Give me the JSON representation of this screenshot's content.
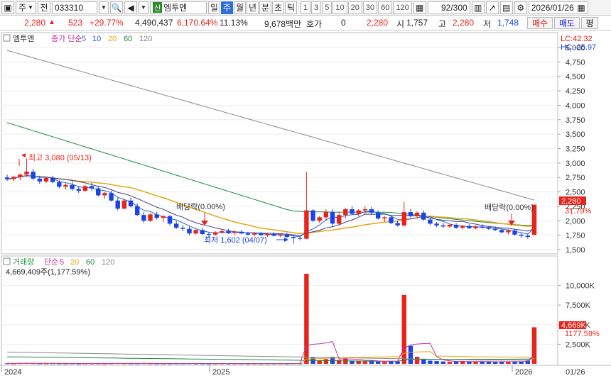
{
  "toolbar": {
    "type_label": "주",
    "mode_label": "전",
    "stock_code": "033310",
    "new_tag": "신",
    "stock_name": "엠투엔",
    "periods": [
      "일",
      "주",
      "월",
      "년",
      "분",
      "초",
      "틱"
    ],
    "active_period": "주",
    "intervals": [
      "1",
      "3",
      "5",
      "10",
      "20",
      "30",
      "60",
      "120"
    ],
    "count": "92",
    "count_total": "/300",
    "date": "2026/01/26"
  },
  "quote": {
    "price": "2,280",
    "change": "523",
    "change_pct": "+29.77%",
    "volume": "4,490,437",
    "volume_pct": "6,170.64%",
    "turnover": "11.13%",
    "amount": "9,678백만",
    "hoga_label": "호가",
    "hoga_value": "0",
    "hoga_price": "2,280",
    "open_label": "시",
    "open": "1,757",
    "high_label": "고",
    "high": "2,280",
    "low_label": "저",
    "low": "1,748",
    "buy_label": "매수",
    "sell_label": "매도",
    "avg_label": "평"
  },
  "price_panel": {
    "legend_name": "엠투엔",
    "legend_items": [
      {
        "label": "종가 단순",
        "color": "#c0309a"
      },
      {
        "label": "5",
        "color": "#2f5fd0"
      },
      {
        "label": "10",
        "color": "#2f5fd0"
      },
      {
        "label": "20",
        "color": "#e6a512"
      },
      {
        "label": "60",
        "color": "#1a8a3c"
      },
      {
        "label": "120",
        "color": "#888888"
      }
    ],
    "lc": "LC:42.32",
    "hc": "HC:-25.97",
    "high_annotation": "최고 3,080 (05/13)",
    "low_annotation": "최저 1,602 (04/07)",
    "div_label_1": "배당락(0.00%)",
    "div_label_2": "배당락(0.00%)",
    "current_price_tag": "2,280",
    "current_pct_tag": "31.79%",
    "y_ticks": [
      "5,000",
      "4,750",
      "4,500",
      "4,250",
      "4,000",
      "3,750",
      "3,500",
      "3,250",
      "3,000",
      "2,750",
      "2,500",
      "2,250",
      "2,000",
      "1,750",
      "1,500"
    ]
  },
  "volume_panel": {
    "legend_name": "거래량",
    "legend_items": [
      {
        "label": "단순",
        "color": "#c0309a"
      },
      {
        "label": "5",
        "color": "#c0309a"
      },
      {
        "label": "20",
        "color": "#e6a512"
      },
      {
        "label": "60",
        "color": "#1a8a3c"
      },
      {
        "label": "120",
        "color": "#888888"
      }
    ],
    "current_volume": "4,669,409주(1,177.59%)",
    "volume_tag": "4,669K",
    "volume_pct_tag": "1177.59%",
    "y_ticks": [
      "10,000K",
      "7,500K",
      "5,000K",
      "2,500K"
    ]
  },
  "x_axis": {
    "labels": [
      "2024",
      "2025",
      "2026"
    ],
    "last_label": "01/26"
  },
  "colors": {
    "up": "#e8231a",
    "down": "#1a44e8",
    "ma5": "#2f5fd0",
    "ma20": "#e6a512",
    "ma60": "#1a8a3c",
    "ma120": "#888888"
  },
  "chart_data": {
    "type": "candlestick",
    "period": "weekly",
    "ylim": [
      1500,
      5000
    ],
    "candles": [
      [
        2750,
        2800,
        2690,
        2720
      ],
      [
        2720,
        2780,
        2680,
        2760
      ],
      [
        2760,
        2820,
        2700,
        2800
      ],
      [
        2800,
        3080,
        2760,
        2850
      ],
      [
        2850,
        2900,
        2700,
        2730
      ],
      [
        2730,
        2780,
        2640,
        2680
      ],
      [
        2680,
        2760,
        2650,
        2740
      ],
      [
        2740,
        2780,
        2650,
        2670
      ],
      [
        2670,
        2700,
        2560,
        2590
      ],
      [
        2590,
        2650,
        2540,
        2620
      ],
      [
        2620,
        2680,
        2520,
        2550
      ],
      [
        2550,
        2600,
        2480,
        2520
      ],
      [
        2520,
        2620,
        2500,
        2600
      ],
      [
        2600,
        2660,
        2520,
        2560
      ],
      [
        2560,
        2600,
        2420,
        2440
      ],
      [
        2440,
        2500,
        2380,
        2480
      ],
      [
        2480,
        2520,
        2330,
        2350
      ],
      [
        2350,
        2400,
        2180,
        2210
      ],
      [
        2210,
        2380,
        2200,
        2350
      ],
      [
        2350,
        2400,
        2230,
        2250
      ],
      [
        2250,
        2300,
        2080,
        2100
      ],
      [
        2100,
        2150,
        1960,
        2000
      ],
      [
        2000,
        2130,
        1980,
        2110
      ],
      [
        2110,
        2150,
        2020,
        2050
      ],
      [
        2050,
        2100,
        1980,
        2080
      ],
      [
        2080,
        2100,
        1920,
        1950
      ],
      [
        1950,
        2000,
        1860,
        1880
      ],
      [
        1880,
        1930,
        1820,
        1860
      ],
      [
        1860,
        1900,
        1750,
        1780
      ],
      [
        1780,
        1850,
        1760,
        1840
      ],
      [
        1840,
        1880,
        1750,
        1770
      ],
      [
        1770,
        1800,
        1700,
        1760
      ],
      [
        1760,
        1820,
        1740,
        1800
      ],
      [
        1800,
        1850,
        1780,
        1820
      ],
      [
        1820,
        1860,
        1770,
        1790
      ],
      [
        1790,
        1830,
        1750,
        1810
      ],
      [
        1810,
        1840,
        1770,
        1780
      ],
      [
        1780,
        1810,
        1740,
        1760
      ],
      [
        1760,
        1800,
        1730,
        1780
      ],
      [
        1780,
        1810,
        1740,
        1750
      ],
      [
        1750,
        1790,
        1720,
        1770
      ],
      [
        1770,
        1800,
        1730,
        1740
      ],
      [
        1740,
        1780,
        1710,
        1760
      ],
      [
        1760,
        1790,
        1700,
        1720
      ],
      [
        1720,
        1760,
        1602,
        1700
      ],
      [
        1700,
        1730,
        1660,
        1690
      ],
      [
        1690,
        2840,
        1680,
        2180
      ],
      [
        2180,
        2200,
        1980,
        2000
      ],
      [
        2000,
        2080,
        1960,
        2060
      ],
      [
        2060,
        2200,
        2000,
        2150
      ],
      [
        2150,
        2200,
        1900,
        1950
      ],
      [
        1950,
        2150,
        1920,
        2100
      ],
      [
        2100,
        2220,
        2040,
        2200
      ],
      [
        2200,
        2250,
        2100,
        2120
      ],
      [
        2120,
        2200,
        2080,
        2180
      ],
      [
        2180,
        2250,
        2120,
        2200
      ],
      [
        2200,
        2240,
        2100,
        2140
      ],
      [
        2140,
        2180,
        2020,
        2040
      ],
      [
        2040,
        2080,
        1980,
        2060
      ],
      [
        2060,
        2080,
        1940,
        1960
      ],
      [
        1960,
        2000,
        1900,
        1920
      ],
      [
        1920,
        2330,
        1900,
        2150
      ],
      [
        2150,
        2200,
        2050,
        2080
      ],
      [
        2080,
        2160,
        2040,
        2140
      ],
      [
        2140,
        2180,
        2000,
        2020
      ],
      [
        2020,
        2050,
        1920,
        1950
      ],
      [
        1950,
        1980,
        1890,
        1920
      ],
      [
        1920,
        1960,
        1880,
        1900
      ],
      [
        1900,
        1950,
        1870,
        1930
      ],
      [
        1930,
        1960,
        1860,
        1880
      ],
      [
        1880,
        1930,
        1850,
        1910
      ],
      [
        1910,
        1940,
        1860,
        1870
      ],
      [
        1870,
        1920,
        1850,
        1900
      ],
      [
        1900,
        1940,
        1860,
        1880
      ],
      [
        1880,
        1910,
        1840,
        1860
      ],
      [
        1860,
        1900,
        1820,
        1840
      ],
      [
        1840,
        1870,
        1780,
        1800
      ],
      [
        1800,
        1850,
        1760,
        1830
      ],
      [
        1830,
        1860,
        1740,
        1760
      ],
      [
        1760,
        1800,
        1700,
        1740
      ],
      [
        1740,
        1780,
        1690,
        1720
      ],
      [
        1757,
        2280,
        1748,
        2280
      ]
    ],
    "volume_k": [
      60,
      40,
      80,
      120,
      70,
      50,
      40,
      60,
      40,
      35,
      50,
      30,
      40,
      45,
      50,
      35,
      60,
      80,
      55,
      45,
      50,
      70,
      40,
      35,
      30,
      40,
      50,
      45,
      60,
      35,
      40,
      30,
      35,
      45,
      30,
      35,
      40,
      25,
      30,
      35,
      30,
      40,
      35,
      30,
      60,
      45,
      11500,
      800,
      400,
      600,
      900,
      500,
      700,
      400,
      350,
      300,
      450,
      300,
      250,
      350,
      300,
      8800,
      2300,
      900,
      600,
      400,
      350,
      300,
      250,
      300,
      350,
      280,
      250,
      300,
      260,
      240,
      300,
      280,
      320,
      260,
      400,
      4669
    ]
  }
}
